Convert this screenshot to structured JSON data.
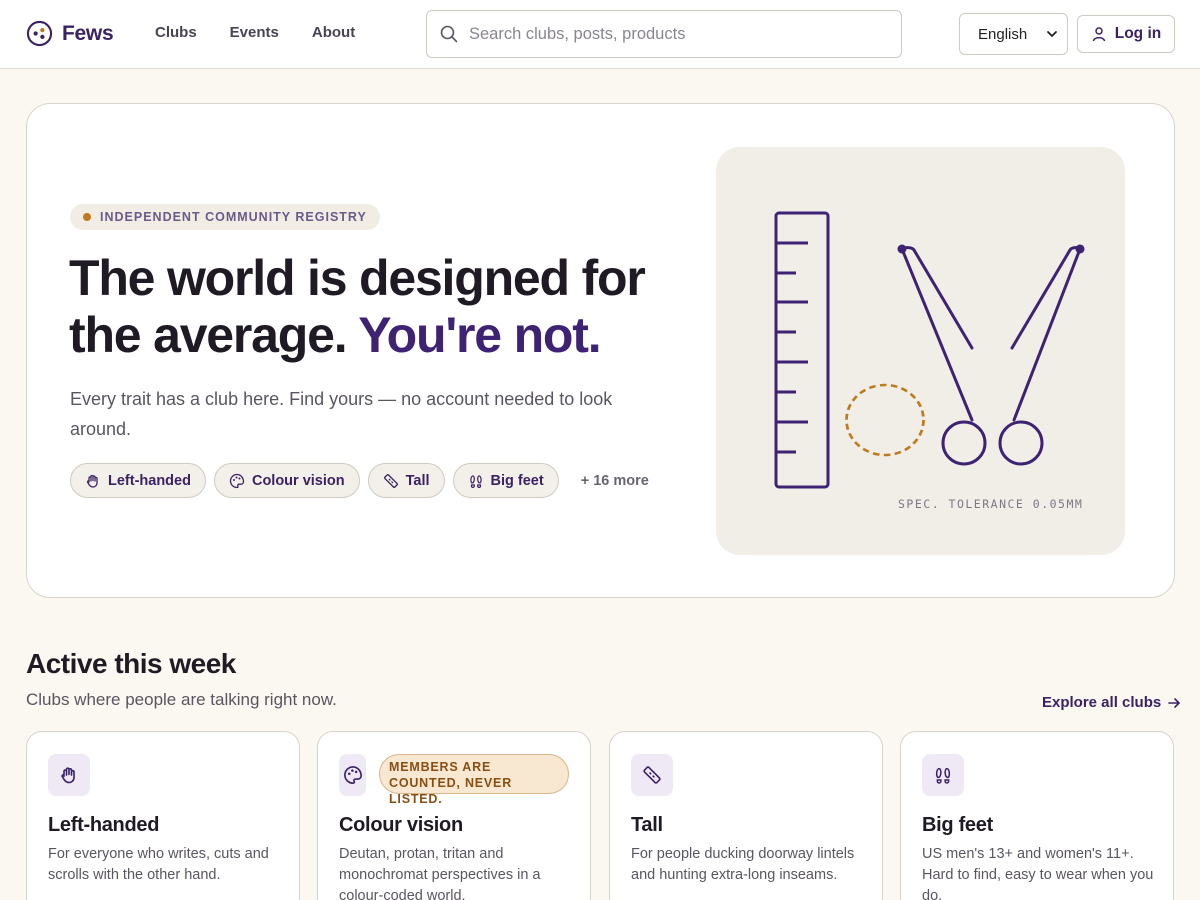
{
  "app": {
    "name": "Fews"
  },
  "nav": {
    "items": [
      "Clubs",
      "Events",
      "About"
    ]
  },
  "search": {
    "placeholder": "Search clubs, posts, products",
    "value": ""
  },
  "language": {
    "selected": "English"
  },
  "login": {
    "label": "Log in"
  },
  "hero": {
    "eyebrow": "INDEPENDENT COMMUNITY REGISTRY",
    "headline_main": "The world is designed for the average.",
    "headline_accent": "You're not.",
    "lede": "Every trait has a club here. Find yours — no account needed to look around.",
    "chips": [
      {
        "label": "Left-handed",
        "icon": "hand-icon"
      },
      {
        "label": "Colour vision",
        "icon": "palette-icon"
      },
      {
        "label": "Tall",
        "icon": "ruler-icon"
      },
      {
        "label": "Big feet",
        "icon": "footprints-icon"
      }
    ],
    "more": "+ 16 more",
    "illustration_caption": "SPEC. TOLERANCE 0.05MM"
  },
  "section": {
    "title": "Active this week",
    "subtitle": "Clubs where people are talking right now.",
    "explore": "Explore all clubs"
  },
  "cards": [
    {
      "title": "Left-handed",
      "desc": "For everyone who writes, cuts and scrolls with the other hand.",
      "icon": "hand-icon"
    },
    {
      "title": "Colour vision",
      "desc": "Deutan, protan, tritan and monochromat perspectives in a colour-coded world.",
      "icon": "palette-icon",
      "badge": "MEMBERS ARE COUNTED, NEVER LISTED."
    },
    {
      "title": "Tall",
      "desc": "For people ducking doorway lintels and hunting extra-long inseams.",
      "icon": "ruler-icon"
    },
    {
      "title": "Big feet",
      "desc": "US men's 13+ and women's 11+. Hard to find, easy to wear when you do.",
      "icon": "footprints-icon"
    }
  ],
  "colors": {
    "brand": "#3b2266",
    "accent": "#c07a1e",
    "background": "#fbf8f1"
  }
}
